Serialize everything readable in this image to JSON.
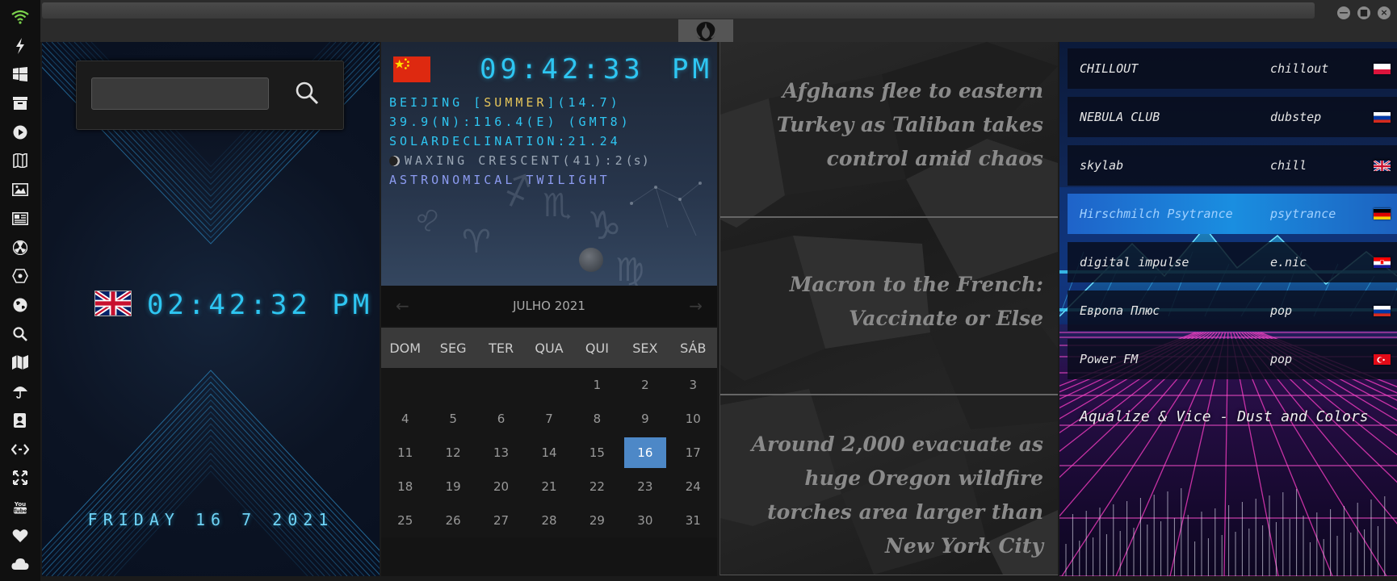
{
  "sidebar": {
    "icons": [
      "wifi-icon",
      "lightning-icon",
      "windows-icon",
      "archive-icon",
      "play-icon",
      "map-book-icon",
      "image-icon",
      "news-icon",
      "radiation-icon",
      "network-icon",
      "globe-icon",
      "search-icon",
      "map-icon",
      "umbrella-icon",
      "contacts-icon",
      "code-icon",
      "expand-icon",
      "youtube-icon",
      "heart-icon",
      "cloud-icon"
    ]
  },
  "window": {
    "emblem": "rebel-alliance-icon",
    "controls": [
      "minimize-icon",
      "maximize-icon",
      "close-icon"
    ]
  },
  "clock1": {
    "search_value": "",
    "time": "02:42:32 PM",
    "date": "FRIDAY 16 7 2021"
  },
  "clock2": {
    "time": "09:42:33",
    "ampm": "PM",
    "city": "BEIJING",
    "season": "SUMMER",
    "daylight": "(14.7)",
    "coords": "39.9(N):116.4(E) (GMT8)",
    "declination": "SOLARDECLINATION:21.24",
    "moon": "WAXING CRESCENT(41):2",
    "moon_unit": "(s)",
    "twilight": "ASTRONOMICAL TWILIGHT"
  },
  "calendar": {
    "month": "JULHO 2021",
    "prev_arrow": "←",
    "next_arrow": "→",
    "weekdays": [
      "DOM",
      "SEG",
      "TER",
      "QUA",
      "QUI",
      "SEX",
      "SÁB"
    ],
    "offset": 4,
    "days": [
      1,
      2,
      3,
      4,
      5,
      6,
      7,
      8,
      9,
      10,
      11,
      12,
      13,
      14,
      15,
      16,
      17,
      18,
      19,
      20,
      21,
      22,
      23,
      24,
      25,
      26,
      27,
      28,
      29,
      30,
      31
    ],
    "today": 16
  },
  "news": {
    "headlines": [
      "Afghans flee to eastern Turkey as Taliban takes control amid chaos",
      "Macron to the French: Vaccinate or Else",
      "Around 2,000 evacuate as huge Oregon wildfire torches area larger than New York City"
    ]
  },
  "radio": {
    "stations": [
      {
        "name": "CHILLOUT",
        "genre": "chillout",
        "flag": "pl"
      },
      {
        "name": "NEBULA CLUB",
        "genre": "dubstep",
        "flag": "ru"
      },
      {
        "name": "skylab",
        "genre": "chill",
        "flag": "uk"
      },
      {
        "name": "Hirschmilch Psytrance",
        "genre": "psytrance",
        "flag": "de"
      },
      {
        "name": "digital impulse",
        "genre": "e.nic",
        "flag": "hr"
      },
      {
        "name": "Европа Плюс",
        "genre": "pop",
        "flag": "ru"
      },
      {
        "name": "Power FM",
        "genre": "pop",
        "flag": "tr"
      }
    ],
    "active_index": 3,
    "now_playing": "Aqualize & Vice - Dust and Colors"
  }
}
